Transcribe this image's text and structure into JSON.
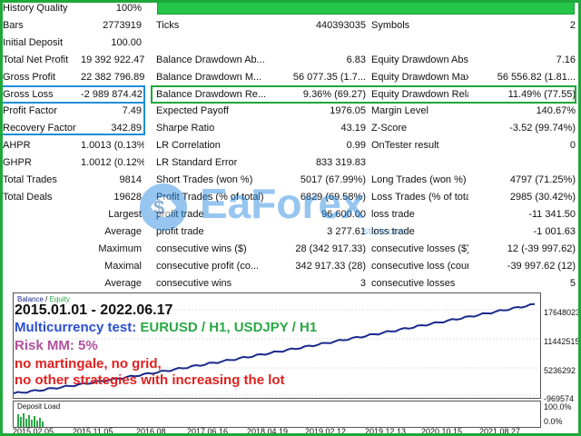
{
  "stats": {
    "history_quality": {
      "label": "History Quality",
      "value": "100%"
    },
    "bars": {
      "label": "Bars",
      "value": "2773919"
    },
    "ticks": {
      "label": "Ticks",
      "value": "440393035"
    },
    "symbols": {
      "label": "Symbols",
      "value": "2"
    },
    "initial_deposit": {
      "label": "Initial Deposit",
      "value": "100.00"
    },
    "total_net_profit": {
      "label": "Total Net Profit",
      "value": "19 392 922.47"
    },
    "balance_dd_abs": {
      "label": "Balance Drawdown Ab...",
      "value": "6.83"
    },
    "equity_dd_abs": {
      "label": "Equity Drawdown Abs...",
      "value": "7.16"
    },
    "gross_profit": {
      "label": "Gross Profit",
      "value": "22 382 796.89"
    },
    "balance_dd_max": {
      "label": "Balance Drawdown M...",
      "value": "56 077.35 (1.7..."
    },
    "equity_dd_max": {
      "label": "Equity Drawdown Max...",
      "value": "56 556.82 (1.81..."
    },
    "gross_loss": {
      "label": "Gross Loss",
      "value": "-2 989 874.42"
    },
    "balance_dd_rel": {
      "label": "Balance Drawdown Re...",
      "value": "9.36% (69.27)"
    },
    "equity_dd_rel": {
      "label": "Equity Drawdown Rela...",
      "value": "11.49% (77.55)"
    },
    "profit_factor": {
      "label": "Profit Factor",
      "value": "7.49"
    },
    "expected_payoff": {
      "label": "Expected Payoff",
      "value": "1976.05"
    },
    "margin_level": {
      "label": "Margin Level",
      "value": "140.67%"
    },
    "recovery_factor": {
      "label": "Recovery Factor",
      "value": "342.89"
    },
    "sharpe_ratio": {
      "label": "Sharpe Ratio",
      "value": "43.19"
    },
    "z_score": {
      "label": "Z-Score",
      "value": "-3.52 (99.74%)"
    },
    "ahpr": {
      "label": "AHPR",
      "value": "1.0013 (0.13%)"
    },
    "lr_correlation": {
      "label": "LR Correlation",
      "value": "0.99"
    },
    "ontester_result": {
      "label": "OnTester result",
      "value": "0"
    },
    "ghpr": {
      "label": "GHPR",
      "value": "1.0012 (0.12%)"
    },
    "lr_std_error": {
      "label": "LR Standard Error",
      "value": "833 319.83"
    },
    "total_trades": {
      "label": "Total Trades",
      "value": "9814"
    },
    "short_trades": {
      "label": "Short Trades (won %)",
      "value": "5017 (67.99%)"
    },
    "long_trades": {
      "label": "Long Trades (won %)",
      "value": "4797 (71.25%)"
    },
    "total_deals": {
      "label": "Total Deals",
      "value": "19628"
    },
    "profit_trades": {
      "label": "Profit Trades (% of total)",
      "value": "6829 (69.58%)"
    },
    "loss_trades": {
      "label": "Loss Trades (% of total)",
      "value": "2985 (30.42%)"
    },
    "largest": {
      "label": "Largest",
      "profit_label": "profit trade",
      "profit_value": "96 600.00",
      "loss_label": "loss trade",
      "loss_value": "-11 341.50"
    },
    "average": {
      "label": "Average",
      "profit_label": "profit trade",
      "profit_value": "3 277.61",
      "loss_label": "loss trade",
      "loss_value": "-1 001.63"
    },
    "maximum": {
      "label": "Maximum",
      "profit_label": "consecutive wins ($)",
      "profit_value": "28 (342 917.33)",
      "loss_label": "consecutive losses ($)",
      "loss_value": "12 (-39 997.62)"
    },
    "maximal": {
      "label": "Maximal",
      "profit_label": "consecutive profit (co...",
      "profit_value": "342 917.33 (28)",
      "loss_label": "consecutive loss (count)",
      "loss_value": "-39 997.62 (12)"
    },
    "average2": {
      "label": "Average",
      "profit_label": "consecutive wins",
      "profit_value": "3",
      "loss_label": "consecutive losses",
      "loss_value": "5"
    }
  },
  "quality_fill_fraction": 1.0,
  "chart": {
    "legend_balance": "Balance",
    "legend_sep": " / ",
    "legend_equity": "Equity",
    "y_ticks": [
      "17648023",
      "11442515",
      "5236292",
      "-969574"
    ],
    "x_ticks": [
      "2015.02.05",
      "2015.11.05",
      "2016.08",
      "2017.06.16",
      "2018.04.19",
      "2019.02.12",
      "2019.12.13",
      "2020.10.15",
      "2021.08.27"
    ],
    "deposit_label": "Deposit Load",
    "deposit_ticks": [
      "100.0%",
      "0.0%"
    ],
    "colors": {
      "balance": "#1b2a8c",
      "equity": "#2aa845",
      "deposit": "#2aa845"
    }
  },
  "overlay": {
    "period": "2015.01.01 - 2022.06.17",
    "test_prefix": "Multicurrency test: ",
    "test_pairs": "EURUSD / H1, USDJPY / H1",
    "risk": "Risk MM: 5%",
    "note1": "no martingale, no grid,",
    "note2": "no other strategies with increasing the lot",
    "colors": {
      "period": "#111111",
      "test": "#2b4fd1",
      "pairs": "#2aa845",
      "risk": "#b0509e",
      "notes": "#e0211f"
    }
  },
  "watermark": {
    "brand": "EaForex",
    "site": "store.com"
  }
}
